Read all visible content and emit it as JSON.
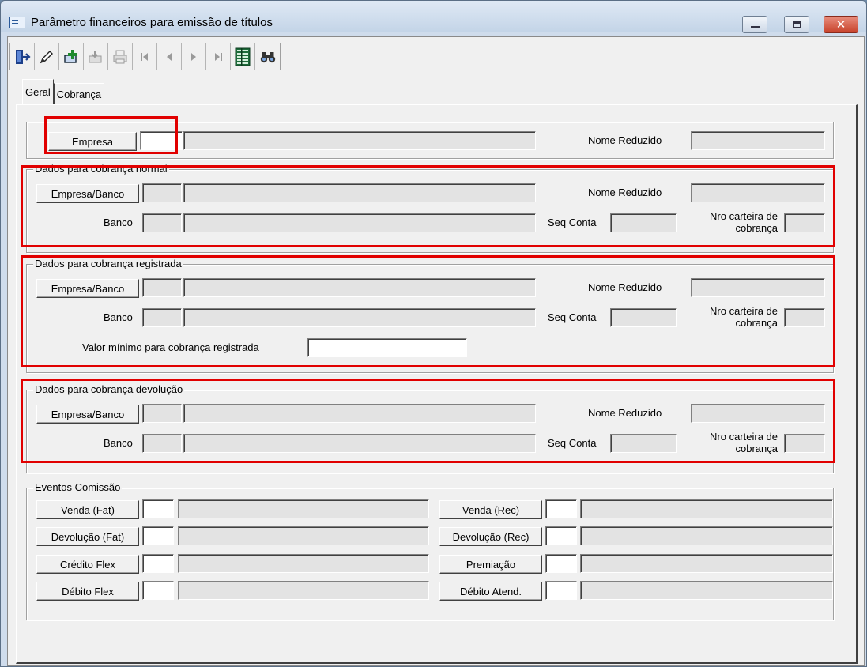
{
  "window": {
    "title": "Parâmetro financeiros para emissão de títulos",
    "caption_buttons": {
      "minimize": "minimize-icon",
      "maximize": "maximize-icon",
      "close": "✕"
    }
  },
  "toolbar": {
    "buttons": [
      {
        "icon": "exit-door-icon",
        "enabled": true
      },
      {
        "icon": "pencil-edit-icon",
        "enabled": true
      },
      {
        "icon": "add-record-icon",
        "enabled": true
      },
      {
        "icon": "save-record-icon",
        "enabled": false
      },
      {
        "icon": "print-icon",
        "enabled": false
      },
      {
        "icon": "first-record-icon",
        "enabled": false
      },
      {
        "icon": "previous-record-icon",
        "enabled": false
      },
      {
        "icon": "next-record-icon",
        "enabled": false
      },
      {
        "icon": "last-record-icon",
        "enabled": false
      },
      {
        "icon": "grid-list-icon",
        "enabled": true
      },
      {
        "icon": "binoculars-search-icon",
        "enabled": true
      }
    ]
  },
  "tabs": [
    {
      "label": "Geral",
      "active": true
    },
    {
      "label": "Cobrança",
      "active": false
    }
  ],
  "empresa_row": {
    "button": "Empresa",
    "nome_reduzido": "Nome Reduzido"
  },
  "normal": {
    "title": "Dados para cobrança normal",
    "empresa_banco": "Empresa/Banco",
    "nome_reduzido": "Nome Reduzido",
    "banco": "Banco",
    "seq_conta": "Seq Conta",
    "nro_carteira": "Nro carteira de cobrança"
  },
  "registrada": {
    "title": "Dados para cobrança registrada",
    "empresa_banco": "Empresa/Banco",
    "nome_reduzido": "Nome Reduzido",
    "banco": "Banco",
    "seq_conta": "Seq Conta",
    "nro_carteira": "Nro carteira de cobrança",
    "valor_minimo": "Valor mínimo para cobrança registrada"
  },
  "devolucao": {
    "title": "Dados para cobrança devolução",
    "empresa_banco": "Empresa/Banco",
    "nome_reduzido": "Nome Reduzido",
    "banco": "Banco",
    "seq_conta": "Seq Conta",
    "nro_carteira": "Nro carteira de cobrança"
  },
  "eventos": {
    "title": "Eventos Comissão",
    "left": [
      "Venda (Fat)",
      "Devolução (Fat)",
      "Crédito Flex",
      "Débito Flex"
    ],
    "right": [
      "Venda (Rec)",
      "Devolução (Rec)",
      "Premiação",
      "Débito Atend."
    ]
  },
  "colors": {
    "highlight": "#e10000",
    "panel": "#f0f0f0",
    "readonly_field": "#e3e3e3"
  }
}
